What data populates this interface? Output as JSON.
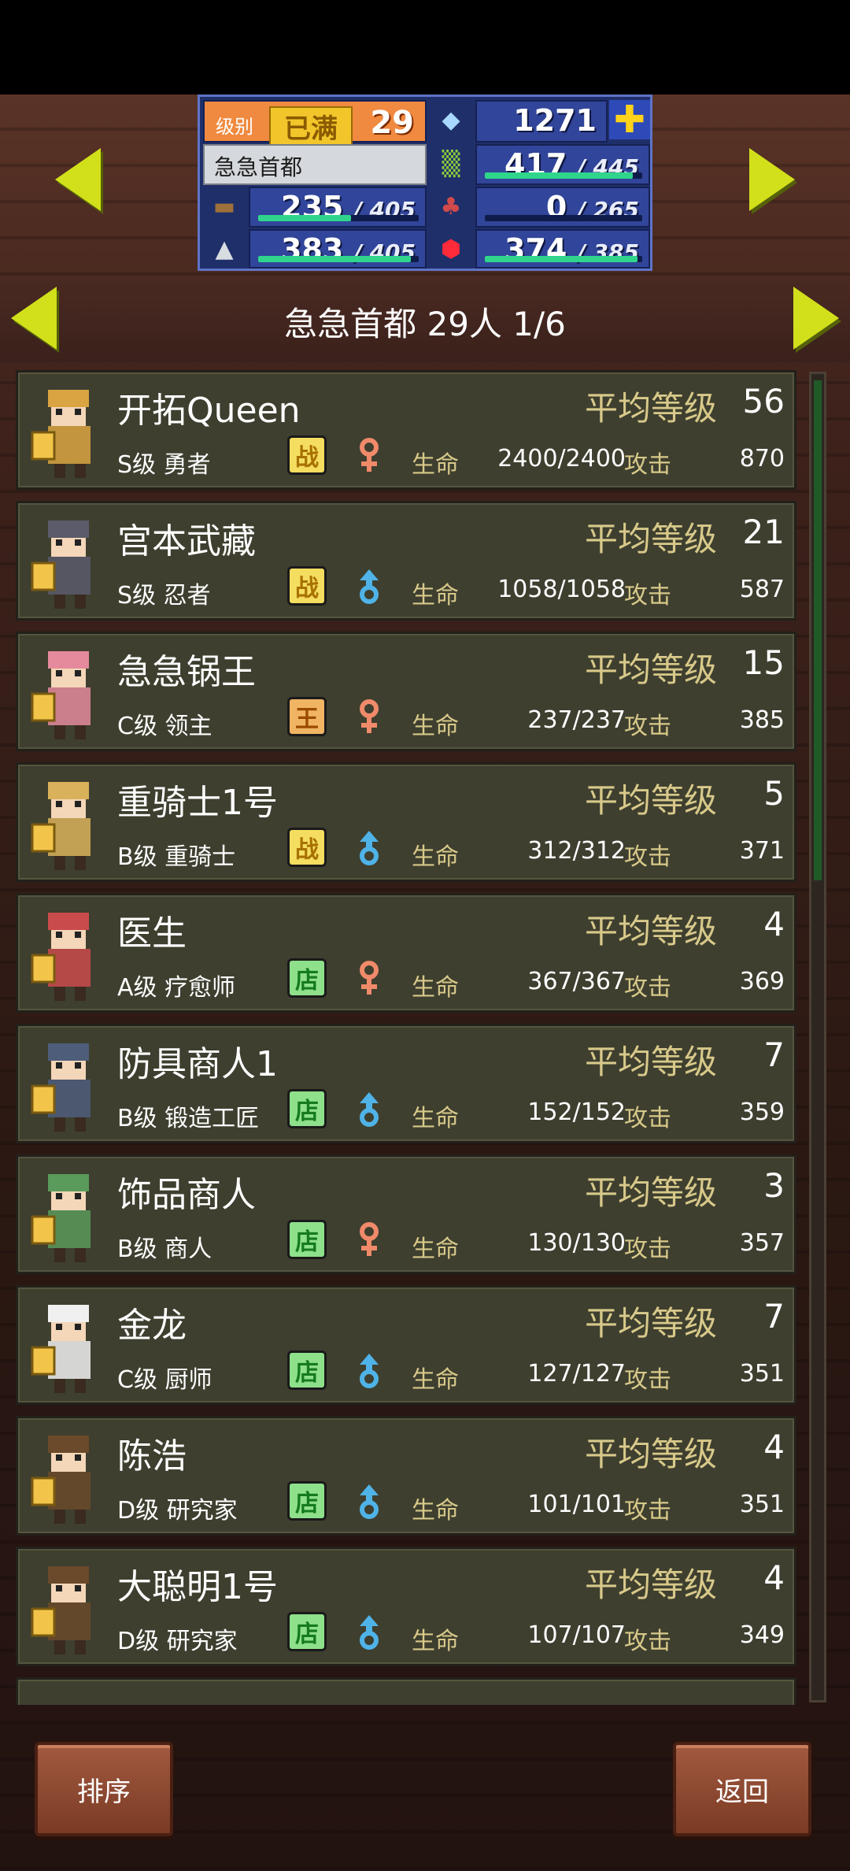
{
  "resources": {
    "level_label": "级别",
    "maxed_label": "已满",
    "level": "29",
    "gems": "1271",
    "town_name": "急急首都",
    "grass": {
      "value": "417",
      "max": "445",
      "fill": 0.94
    },
    "wood": {
      "value": "235",
      "max": "405",
      "fill": 0.58
    },
    "food": {
      "value": "0",
      "max": "265",
      "fill": 0.0
    },
    "ore": {
      "value": "383",
      "max": "405",
      "fill": 0.95
    },
    "mana": {
      "value": "374",
      "max": "385",
      "fill": 0.97
    }
  },
  "header": {
    "title": "急急首都  29人 1/6"
  },
  "labels": {
    "avg_level": "平均等级",
    "hp": "生命",
    "attack": "攻击"
  },
  "characters": [
    {
      "name": "开拓Queen",
      "class": "S级 勇者",
      "badge": "战",
      "badge_type": "battle",
      "gender": "female",
      "level": "56",
      "hp": "2400/2400",
      "attack": "870",
      "avatar_color": "#d9a441"
    },
    {
      "name": "宫本武藏",
      "class": "S级 忍者",
      "badge": "战",
      "badge_type": "battle",
      "gender": "male",
      "level": "21",
      "hp": "1058/1058",
      "attack": "587",
      "avatar_color": "#5b5b6b"
    },
    {
      "name": "急急锅王",
      "class": "C级 领主",
      "badge": "王",
      "badge_type": "king",
      "gender": "female",
      "level": "15",
      "hp": "237/237",
      "attack": "385",
      "avatar_color": "#e48a9c"
    },
    {
      "name": "重骑士1号",
      "class": "B级 重骑士",
      "badge": "战",
      "badge_type": "battle",
      "gender": "male",
      "level": "5",
      "hp": "312/312",
      "attack": "371",
      "avatar_color": "#d9b15a"
    },
    {
      "name": "医生",
      "class": "A级 疗愈师",
      "badge": "店",
      "badge_type": "shop",
      "gender": "female",
      "level": "4",
      "hp": "367/367",
      "attack": "369",
      "avatar_color": "#c94b4b"
    },
    {
      "name": "防具商人1",
      "class": "B级 锻造工匠",
      "badge": "店",
      "badge_type": "shop",
      "gender": "male",
      "level": "7",
      "hp": "152/152",
      "attack": "359",
      "avatar_color": "#4e5d7a"
    },
    {
      "name": "饰品商人",
      "class": "B级 商人",
      "badge": "店",
      "badge_type": "shop",
      "gender": "female",
      "level": "3",
      "hp": "130/130",
      "attack": "357",
      "avatar_color": "#5a9a5a"
    },
    {
      "name": "金龙",
      "class": "C级 厨师",
      "badge": "店",
      "badge_type": "shop",
      "gender": "male",
      "level": "7",
      "hp": "127/127",
      "attack": "351",
      "avatar_color": "#f0f0f0"
    },
    {
      "name": "陈浩",
      "class": "D级 研究家",
      "badge": "店",
      "badge_type": "shop",
      "gender": "male",
      "level": "4",
      "hp": "101/101",
      "attack": "351",
      "avatar_color": "#6a4a2a"
    },
    {
      "name": "大聪明1号",
      "class": "D级 研究家",
      "badge": "店",
      "badge_type": "shop",
      "gender": "male",
      "level": "4",
      "hp": "107/107",
      "attack": "349",
      "avatar_color": "#6a4a2a"
    }
  ],
  "buttons": {
    "sort": "排序",
    "back": "返回"
  },
  "colors": {
    "female": "#f08a6a",
    "male": "#4fb3e8"
  }
}
